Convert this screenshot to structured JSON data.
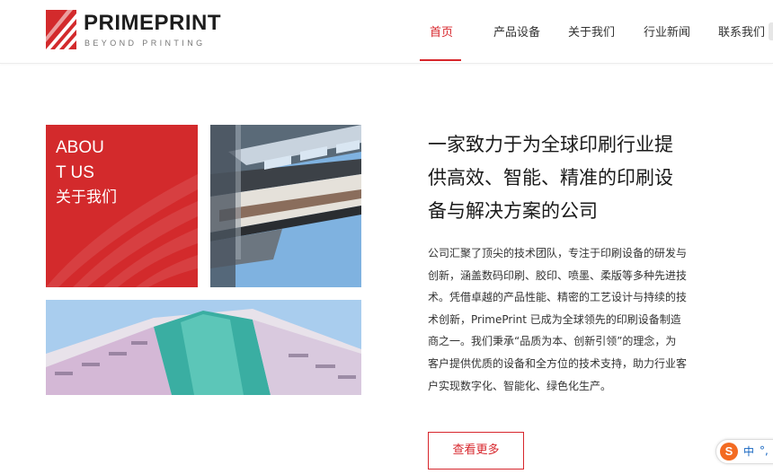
{
  "brand": {
    "name": "PRIMEPRINT",
    "tagline": "BEYOND PRINTING",
    "accent_color": "#d7262c"
  },
  "nav": {
    "items": [
      {
        "label": "首页",
        "active": true
      },
      {
        "label": "产品设备",
        "active": false
      },
      {
        "label": "关于我们",
        "active": false
      },
      {
        "label": "行业新闻",
        "active": false
      },
      {
        "label": "联系我们",
        "active": false
      }
    ]
  },
  "about": {
    "tile_title_en": "ABOUT US",
    "tile_title_cn": "关于我们",
    "headline": "一家致力于为全球印刷行业提供高效、智能、精准的印刷设备与解决方案的公司",
    "body": "公司汇聚了顶尖的技术团队，专注于印刷设备的研发与创新，涵盖数码印刷、胶印、喷墨、柔版等多种先进技术。凭借卓越的产品性能、精密的工艺设计与持续的技术创新，PrimePrint 已成为全球领先的印刷设备制造商之一。我们秉承“品质为本、创新引领”的理念，为客户提供优质的设备和全方位的技术支持，助力行业客户实现数字化、智能化、绿色化生产。",
    "more_button": "查看更多"
  },
  "ime": {
    "logo": "S",
    "mode": "中",
    "punct": "°,"
  }
}
